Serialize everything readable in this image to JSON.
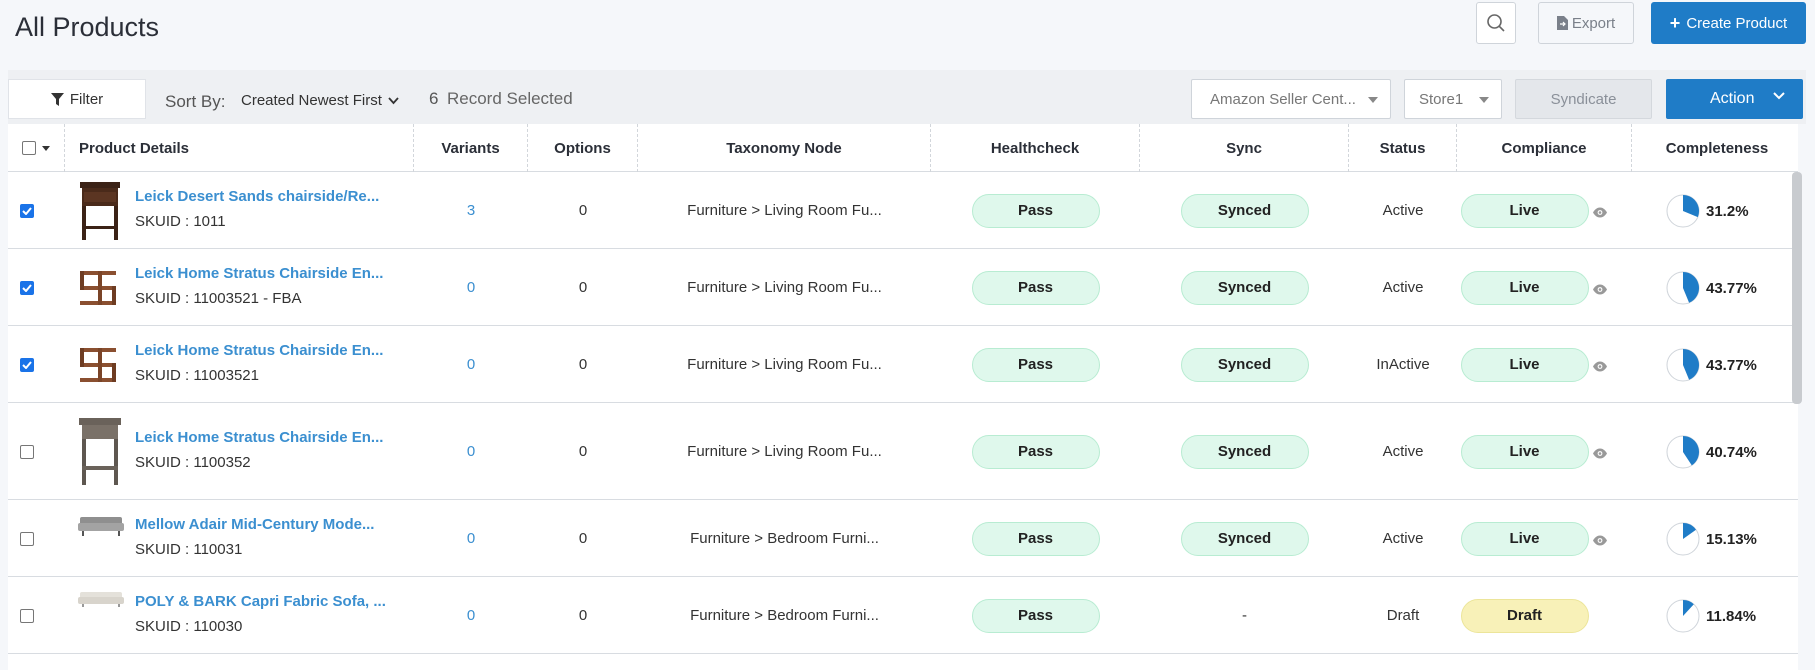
{
  "header": {
    "title": "All Products",
    "export_label": "Export",
    "create_label": "Create Product"
  },
  "toolbar": {
    "filter_label": "Filter",
    "sortby_label": "Sort By:",
    "sortby_value": "Created Newest First",
    "record_count": "6",
    "record_label": "Record Selected",
    "channel_select": "Amazon Seller Cent...",
    "store_select": "Store1",
    "syndicate_label": "Syndicate",
    "action_label": "Action"
  },
  "columns": {
    "product_details": "Product Details",
    "variants": "Variants",
    "options": "Options",
    "taxonomy": "Taxonomy Node",
    "healthcheck": "Healthcheck",
    "sync": "Sync",
    "status": "Status",
    "compliance": "Compliance",
    "completeness": "Completeness"
  },
  "rows": [
    {
      "checked": true,
      "name": "Leick Desert Sands chairside/Re...",
      "sku": "SKUID : 1011",
      "variants": "3",
      "options": "0",
      "taxonomy": "Furniture > Living Room Fu...",
      "healthcheck": "Pass",
      "sync": "Synced",
      "status": "Active",
      "compliance": "Live",
      "completeness": "31.2%",
      "completeness_value": 31.2,
      "thumb": "side-table-dark"
    },
    {
      "checked": true,
      "name": "Leick Home Stratus Chairside En...",
      "sku": "SKUID : 11003521 - FBA",
      "variants": "0",
      "options": "0",
      "taxonomy": "Furniture > Living Room Fu...",
      "healthcheck": "Pass",
      "sync": "Synced",
      "status": "Active",
      "compliance": "Live",
      "completeness": "43.77%",
      "completeness_value": 43.77,
      "thumb": "shelf-brown"
    },
    {
      "checked": true,
      "name": "Leick Home Stratus Chairside En...",
      "sku": "SKUID : 11003521",
      "variants": "0",
      "options": "0",
      "taxonomy": "Furniture > Living Room Fu...",
      "healthcheck": "Pass",
      "sync": "Synced",
      "status": "InActive",
      "compliance": "Live",
      "completeness": "43.77%",
      "completeness_value": 43.77,
      "thumb": "shelf-brown"
    },
    {
      "checked": false,
      "name": "Leick Home Stratus Chairside En...",
      "sku": "SKUID : 1100352",
      "variants": "0",
      "options": "0",
      "taxonomy": "Furniture > Living Room Fu...",
      "healthcheck": "Pass",
      "sync": "Synced",
      "status": "Active",
      "compliance": "Live",
      "completeness": "40.74%",
      "completeness_value": 40.74,
      "thumb": "side-table-grey"
    },
    {
      "checked": false,
      "name": "Mellow Adair Mid-Century Mode...",
      "sku": "SKUID : 110031",
      "variants": "0",
      "options": "0",
      "taxonomy": "Furniture > Bedroom Furni...",
      "healthcheck": "Pass",
      "sync": "Synced",
      "status": "Active",
      "compliance": "Live",
      "completeness": "15.13%",
      "completeness_value": 15.13,
      "thumb": "sofa-grey"
    },
    {
      "checked": false,
      "name": "POLY & BARK Capri Fabric Sofa, ...",
      "sku": "SKUID : 110030",
      "variants": "0",
      "options": "0",
      "taxonomy": "Furniture > Bedroom Furni...",
      "healthcheck": "Pass",
      "sync": "-",
      "status": "Draft",
      "compliance": "Draft",
      "completeness": "11.84%",
      "completeness_value": 11.84,
      "thumb": "sofa-white"
    }
  ],
  "colors": {
    "accent": "#1f7cc7",
    "link": "#3b8fd0",
    "pass_bg": "#dff8ec",
    "draft_bg": "#f8f1b8"
  }
}
